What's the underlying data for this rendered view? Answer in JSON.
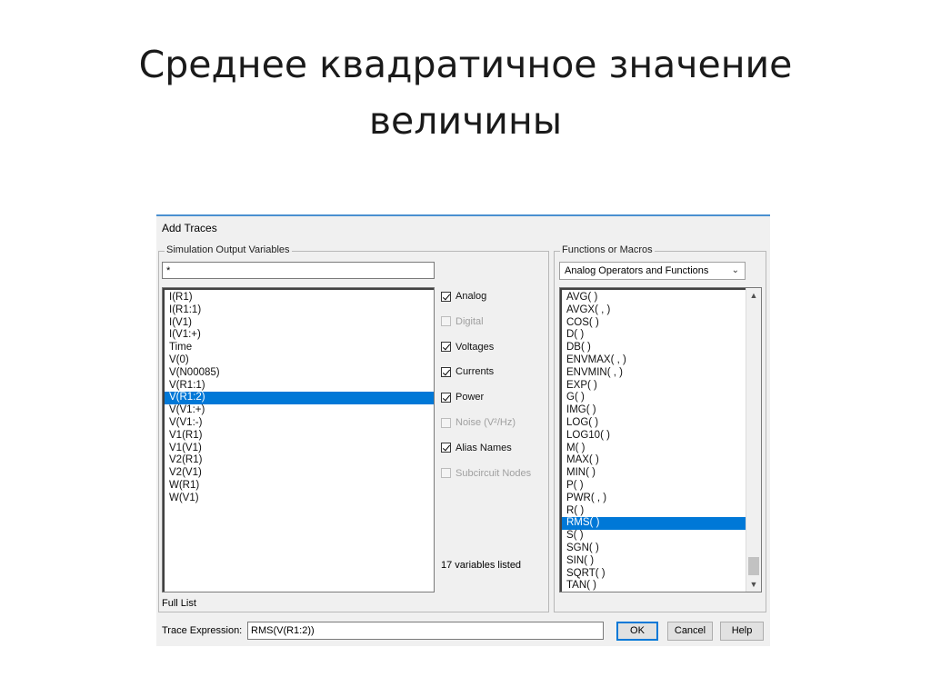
{
  "slide": {
    "title_line1": "Среднее квадратичное  значение",
    "title_line2": "величины"
  },
  "dialog": {
    "title": "Add Traces",
    "sim_group_label": "Simulation Output Variables",
    "filter_value": "*",
    "variables": [
      "I(R1)",
      "I(R1:1)",
      "I(V1)",
      "I(V1:+)",
      "Time",
      "V(0)",
      "V(N00085)",
      "V(R1:1)",
      "V(R1:2)",
      "V(V1:+)",
      "V(V1:-)",
      "V1(R1)",
      "V1(V1)",
      "V2(R1)",
      "V2(V1)",
      "W(R1)",
      "W(V1)"
    ],
    "selected_variable": "V(R1:2)",
    "checkboxes": [
      {
        "label": "Analog",
        "checked": true,
        "enabled": true
      },
      {
        "label": "Digital",
        "checked": false,
        "enabled": false
      },
      {
        "label": "Voltages",
        "checked": true,
        "enabled": true
      },
      {
        "label": "Currents",
        "checked": true,
        "enabled": true
      },
      {
        "label": "Power",
        "checked": true,
        "enabled": true
      },
      {
        "label": "Noise (V²/Hz)",
        "checked": false,
        "enabled": false
      },
      {
        "label": "Alias Names",
        "checked": true,
        "enabled": true
      },
      {
        "label": "Subcircuit Nodes",
        "checked": false,
        "enabled": false
      }
    ],
    "variables_count": "17 variables listed",
    "full_list_label": "Full List",
    "functions_group_label": "Functions or Macros",
    "functions_select": "Analog Operators and Functions",
    "functions": [
      "AVG( )",
      "AVGX( , )",
      "COS( )",
      "D( )",
      "DB( )",
      "ENVMAX( , )",
      "ENVMIN( , )",
      "EXP( )",
      "G( )",
      "IMG( )",
      "LOG( )",
      "LOG10( )",
      "M( )",
      "MAX( )",
      "MIN( )",
      "P( )",
      "PWR( , )",
      "R( )",
      "RMS( )",
      "S( )",
      "SGN( )",
      "SIN( )",
      "SQRT( )",
      "TAN( )"
    ],
    "selected_function": "RMS( )",
    "trace_expression_label": "Trace Expression:",
    "trace_expression_value": "RMS(V(R1:2))",
    "ok_label": "OK",
    "cancel_label": "Cancel",
    "help_label": "Help",
    "accent_color": "#0078d7"
  }
}
